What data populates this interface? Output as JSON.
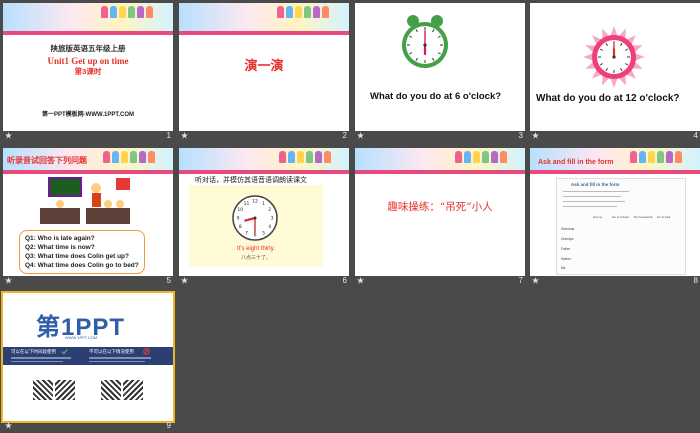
{
  "slides": [
    {
      "number": "1",
      "title_cn": "陕旅版英语五年级上册",
      "unit": "Unit1 Get up on time",
      "lesson": "第3课时",
      "footer": "第一PPT模板网-WWW.1PPT.COM"
    },
    {
      "number": "2",
      "title": "演一演"
    },
    {
      "number": "3",
      "question": "What do you do at 6 o'clock?",
      "clock_hour": 6,
      "clock_minute": 0
    },
    {
      "number": "4",
      "question": "What do you do at 12 o'clock?",
      "clock_hour": 12,
      "clock_minute": 0
    },
    {
      "number": "5",
      "title": "听录音试回答下列问题",
      "questions": [
        "Q1: Who is late again?",
        "Q2: What time is now?",
        "Q3: What time does Colin  get up?",
        "Q4: What time does Colin  go to bed?"
      ]
    },
    {
      "number": "6",
      "title": "听对话，并模仿其语音语调朗读课文",
      "clock_hour": 8,
      "clock_minute": 30,
      "caption_en": "It's eight thirty.",
      "caption_cn": "八点三十了。"
    },
    {
      "number": "7",
      "title": "趣味操练：“吊死”小人"
    },
    {
      "number": "8",
      "title": "Ask and fill in the form",
      "worksheet_title": "Ask and fill in the form",
      "col_headers": [
        "Get up",
        "Go to school",
        "Do homework",
        "Go to bed"
      ],
      "row_labels": [
        "Grandma",
        "Grandpa",
        "Father",
        "Mother",
        "Me"
      ]
    },
    {
      "number": "9",
      "logo": "第1PPT",
      "logo_sub": "WWW.1PPT.COM",
      "can_title": "可以在以下时间段使用",
      "cannot_title": "不可以在以下情况使用"
    }
  ],
  "colors": {
    "accent_red": "#e4312b",
    "brand_blue": "#2f5fa8",
    "selection": "#f0b429"
  }
}
